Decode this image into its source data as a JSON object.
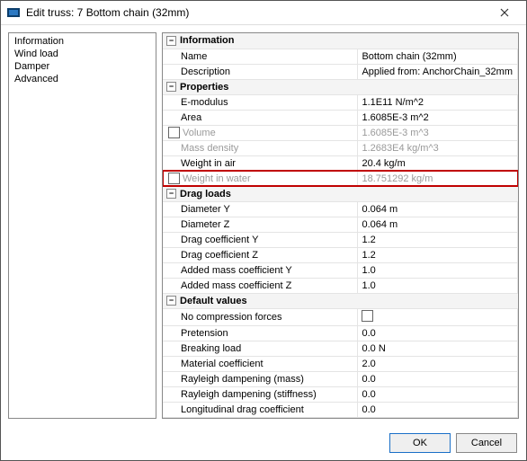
{
  "window": {
    "title": "Edit truss: 7 Bottom chain (32mm)"
  },
  "sidebar": {
    "items": [
      {
        "label": "Information"
      },
      {
        "label": "Wind load"
      },
      {
        "label": "Damper"
      },
      {
        "label": "Advanced"
      }
    ]
  },
  "sections": {
    "information": {
      "header": "Information",
      "name_label": "Name",
      "name_value": "Bottom chain (32mm)",
      "description_label": "Description",
      "description_value": "Applied from: AnchorChain_32mm"
    },
    "properties": {
      "header": "Properties",
      "emodulus_label": "E-modulus",
      "emodulus_value": "1.1E11 N/m^2",
      "area_label": "Area",
      "area_value": "1.6085E-3 m^2",
      "volume_label": "Volume",
      "volume_value": "1.6085E-3 m^3",
      "massdensity_label": "Mass density",
      "massdensity_value": "1.2683E4 kg/m^3",
      "weightair_label": "Weight in air",
      "weightair_value": "20.4 kg/m",
      "weightwater_label": "Weight in water",
      "weightwater_value": "18.751292 kg/m"
    },
    "dragloads": {
      "header": "Drag loads",
      "diamy_label": "Diameter Y",
      "diamy_value": "0.064 m",
      "diamz_label": "Diameter Z",
      "diamz_value": "0.064 m",
      "dragy_label": "Drag coefficient Y",
      "dragy_value": "1.2",
      "dragz_label": "Drag coefficient Z",
      "dragz_value": "1.2",
      "addy_label": "Added mass coefficient Y",
      "addy_value": "1.0",
      "addz_label": "Added mass coefficient Z",
      "addz_value": "1.0"
    },
    "defaults": {
      "header": "Default values",
      "nocomp_label": "No compression forces",
      "pretension_label": "Pretension",
      "pretension_value": "0.0",
      "breaking_label": "Breaking load",
      "breaking_value": "0.0 N",
      "material_label": "Material coefficient",
      "material_value": "2.0",
      "raymass_label": "Rayleigh dampening (mass)",
      "raymass_value": "0.0",
      "raystiff_label": "Rayleigh dampening (stiffness)",
      "raystiff_value": "0.0",
      "longdrag_label": "Longitudinal drag coefficient",
      "longdrag_value": "0.0"
    }
  },
  "buttons": {
    "ok": "OK",
    "cancel": "Cancel"
  }
}
